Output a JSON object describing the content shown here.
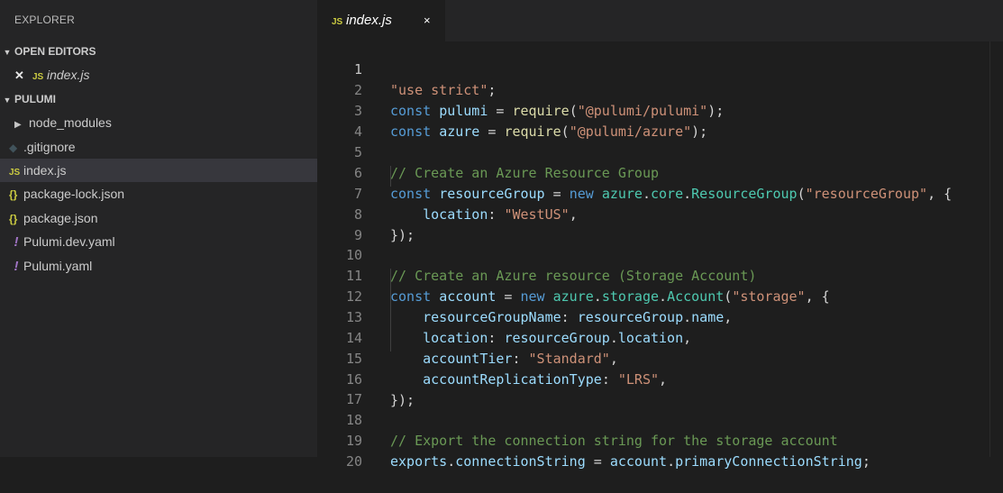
{
  "sidebar": {
    "title": "EXPLORER",
    "open_editors": {
      "header": "OPEN EDITORS",
      "items": [
        {
          "icon": "JS",
          "label": "index.js"
        }
      ]
    },
    "project": {
      "header": "PULUMI",
      "items": [
        {
          "icon": "folder-chevron",
          "label": "node_modules"
        },
        {
          "icon": "git",
          "label": ".gitignore"
        },
        {
          "icon": "JS",
          "label": "index.js"
        },
        {
          "icon": "{}",
          "label": "package-lock.json"
        },
        {
          "icon": "{}",
          "label": "package.json"
        },
        {
          "icon": "!",
          "label": "Pulumi.dev.yaml"
        },
        {
          "icon": "!",
          "label": "Pulumi.yaml"
        }
      ]
    }
  },
  "tabs": [
    {
      "icon": "JS",
      "label": "index.js",
      "close": "×"
    }
  ],
  "editor": {
    "current_line": 1,
    "lines": [
      {
        "n": "1"
      },
      {
        "n": "2"
      },
      {
        "n": "3"
      },
      {
        "n": "4"
      },
      {
        "n": "5"
      },
      {
        "n": "6"
      },
      {
        "n": "7"
      },
      {
        "n": "8"
      },
      {
        "n": "9"
      },
      {
        "n": "10"
      },
      {
        "n": "11"
      },
      {
        "n": "12"
      },
      {
        "n": "13"
      },
      {
        "n": "14"
      },
      {
        "n": "15"
      },
      {
        "n": "16"
      },
      {
        "n": "17"
      },
      {
        "n": "18"
      },
      {
        "n": "19"
      },
      {
        "n": "20"
      }
    ],
    "code": {
      "l1_str": "\"use strict\"",
      "l1_end": ";",
      "l2_kw": "const",
      "l2_var": "pulumi",
      "l2_eq": " = ",
      "l2_fn": "require",
      "l2_open": "(",
      "l2_str": "\"@pulumi/pulumi\"",
      "l2_end": ");",
      "l3_kw": "const",
      "l3_var": "azure",
      "l3_eq": " = ",
      "l3_fn": "require",
      "l3_open": "(",
      "l3_str": "\"@pulumi/azure\"",
      "l3_end": ");",
      "l5_cm": "// Create an Azure Resource Group",
      "l6_kw": "const",
      "l6_var": "resourceGroup",
      "l6_eq": " = ",
      "l6_new": "new",
      "l6_a": "azure",
      "l6_d1": ".",
      "l6_b": "core",
      "l6_d2": ".",
      "l6_cls": "ResourceGroup",
      "l6_open": "(",
      "l6_str": "\"resourceGroup\"",
      "l6_end": ", {",
      "l7_prop": "location",
      "l7_colon": ": ",
      "l7_str": "\"WestUS\"",
      "l7_end": ",",
      "l8": "});",
      "l10_cm": "// Create an Azure resource (Storage Account)",
      "l11_kw": "const",
      "l11_var": "account",
      "l11_eq": " = ",
      "l11_new": "new",
      "l11_a": "azure",
      "l11_d1": ".",
      "l11_b": "storage",
      "l11_d2": ".",
      "l11_cls": "Account",
      "l11_open": "(",
      "l11_str": "\"storage\"",
      "l11_end": ", {",
      "l12_prop": "resourceGroupName",
      "l12_colon": ": ",
      "l12_v1": "resourceGroup",
      "l12_d": ".",
      "l12_v2": "name",
      "l12_end": ",",
      "l13_prop": "location",
      "l13_colon": ": ",
      "l13_v1": "resourceGroup",
      "l13_d": ".",
      "l13_v2": "location",
      "l13_end": ",",
      "l14_prop": "accountTier",
      "l14_colon": ": ",
      "l14_str": "\"Standard\"",
      "l14_end": ",",
      "l15_prop": "accountReplicationType",
      "l15_colon": ": ",
      "l15_str": "\"LRS\"",
      "l15_end": ",",
      "l16": "});",
      "l18_cm": "// Export the connection string for the storage account",
      "l19_v1": "exports",
      "l19_d1": ".",
      "l19_v2": "connectionString",
      "l19_eq": " = ",
      "l19_v3": "account",
      "l19_d2": ".",
      "l19_v4": "primaryConnectionString",
      "l19_end": ";"
    }
  },
  "colors": {
    "sidebar_bg": "#252526",
    "editor_bg": "#1e1e1e",
    "keyword": "#569cd6",
    "string": "#ce9178",
    "comment": "#6a9955",
    "function": "#dcdcaa",
    "class": "#4ec9b0",
    "variable": "#9cdcfe"
  }
}
